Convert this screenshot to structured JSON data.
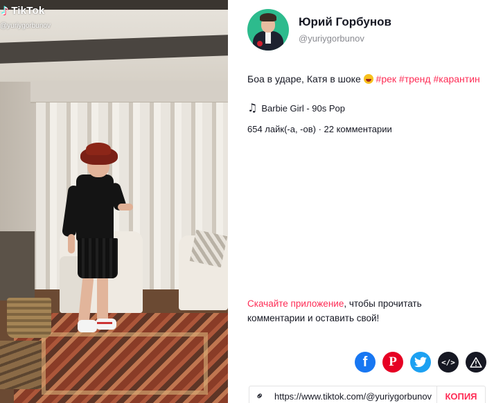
{
  "video": {
    "watermark_logo": "TikTok",
    "watermark_handle": "@yuriygorbunov"
  },
  "author": {
    "name": "Юрий Горбунов",
    "handle": "@yuriygorbunov"
  },
  "caption": {
    "text": "Боа в ударе, Катя в шоке",
    "emoji": "face-with-tongue-emoji",
    "tags": [
      "#рек",
      "#тренд",
      "#карантин"
    ]
  },
  "music": {
    "title": "Barbie Girl - 90s Pop",
    "icon": "music-note-icon"
  },
  "stats": {
    "text": "654 лайк(-а, -ов) · 22 комментарии"
  },
  "cta": {
    "link_text": "Скачайте приложение",
    "rest": ", чтобы прочитать комментарии и оставить свой!"
  },
  "share": {
    "buttons": [
      {
        "name": "facebook",
        "glyph": "f",
        "color": "#1877f2"
      },
      {
        "name": "pinterest",
        "glyph": "P",
        "color": "#e60023"
      },
      {
        "name": "twitter",
        "glyph": "",
        "color": "#1da1f2"
      },
      {
        "name": "embed",
        "glyph": "</>",
        "color": "#161823"
      },
      {
        "name": "report",
        "glyph": "",
        "color": "#161823"
      }
    ]
  },
  "link": {
    "url": "https://www.tiktok.com/@yuriygorbunov",
    "copy_label": "КОПИЯ"
  },
  "colors": {
    "accent": "#fe2c55",
    "text": "#161823",
    "muted": "#8a8b91"
  }
}
